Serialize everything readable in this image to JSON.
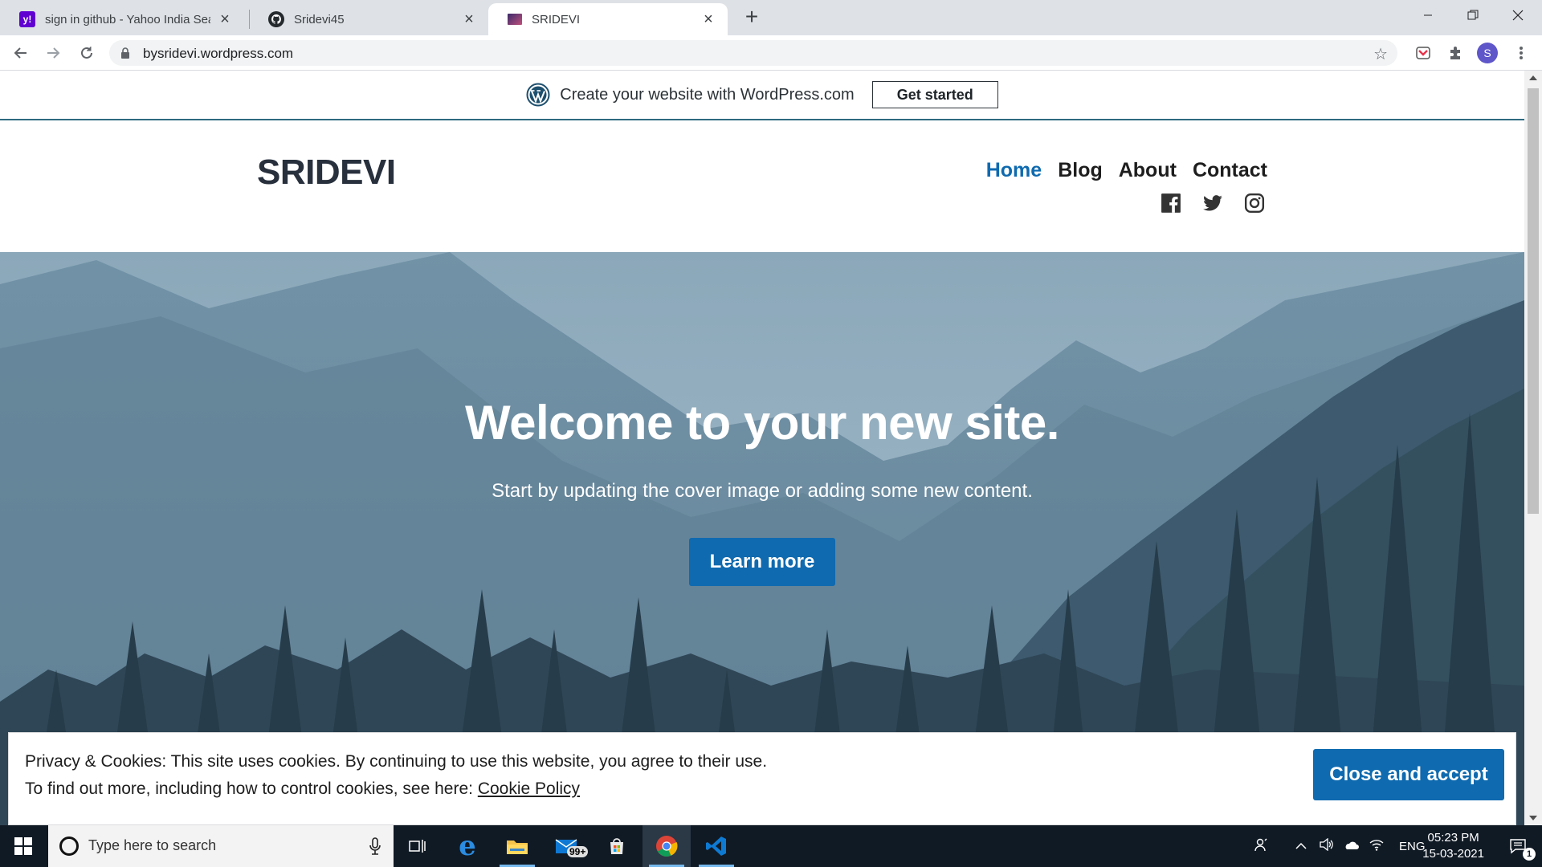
{
  "browser": {
    "tabs": [
      {
        "title": "sign in github - Yahoo India Search",
        "favicon": "yahoo-icon"
      },
      {
        "title": "Sridevi45",
        "favicon": "github-icon"
      },
      {
        "title": "SRIDEVI",
        "favicon": "site-icon"
      }
    ],
    "url": "bysridevi.wordpress.com",
    "profile_initial": "S"
  },
  "wpbar": {
    "text": "Create your website with WordPress.com",
    "button": "Get started"
  },
  "site": {
    "title": "SRIDEVI",
    "nav": [
      "Home",
      "Blog",
      "About",
      "Contact"
    ],
    "current_nav": "Home",
    "social": [
      "facebook-icon",
      "twitter-icon",
      "instagram-icon"
    ]
  },
  "cover": {
    "headline": "Welcome to your new site.",
    "subtitle": "Start by updating the cover image or adding some new content.",
    "button": "Learn more"
  },
  "cookie": {
    "line1": "Privacy & Cookies: This site uses cookies. By continuing to use this website, you agree to their use.",
    "line2_prefix": "To find out more, including how to control cookies, see here: ",
    "link": "Cookie Policy",
    "button": "Close and accept"
  },
  "taskbar": {
    "search_placeholder": "Type here to search",
    "mail_badge": "99+",
    "language": "ENG",
    "time": "05:23 PM",
    "date": "15-03-2021",
    "notification_count": "1"
  },
  "colors": {
    "accent": "#0f6aaf",
    "chrome_tabstrip": "#dee1e6",
    "taskbar": "#101a25"
  }
}
